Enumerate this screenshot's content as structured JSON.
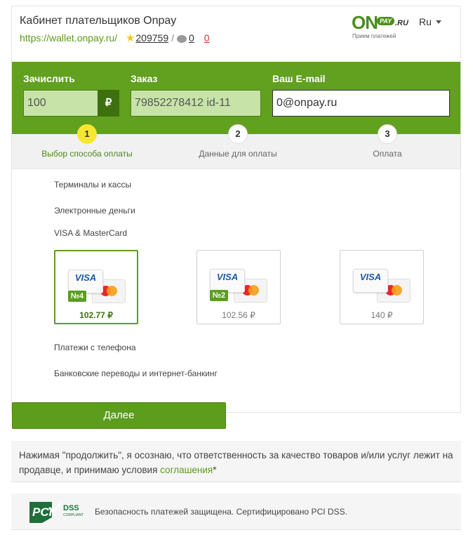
{
  "header": {
    "title": "Кабинет плательщиков Onpay",
    "url": "https://wallet.onpay.ru/",
    "rating": "209759",
    "comments": "0",
    "negative": "0",
    "logo": {
      "on": "ON",
      "pay": "PAY",
      "ru": ".RU",
      "tagline": "Прием платежей"
    },
    "lang": "Ru"
  },
  "form": {
    "amount_label": "Зачислить",
    "amount_value": "100",
    "currency": "₽",
    "order_label": "Заказ",
    "order_value": "79852278412 id-11",
    "email_label": "Ваш E-mail",
    "email_value": "0@onpay.ru"
  },
  "steps": [
    {
      "num": "1",
      "label": "Выбор способа оплаты"
    },
    {
      "num": "2",
      "label": "Данные для оплаты"
    },
    {
      "num": "3",
      "label": "Оплата"
    }
  ],
  "methods": {
    "terminals": "Терминалы и кассы",
    "emoney": "Электронные деньги",
    "cards": "VISA & MasterCard",
    "phone": "Платежи с телефона",
    "bank": "Банковские переводы и интернет-банкинг"
  },
  "card_options": [
    {
      "brand": "VISA",
      "badge": "№4",
      "price": "102.77 ₽"
    },
    {
      "brand": "VISA",
      "badge": "№2",
      "price": "102.56 ₽"
    },
    {
      "brand": "VISA",
      "badge": "",
      "price": "140 ₽"
    }
  ],
  "next_button": "Далее",
  "notice": {
    "text": "Нажимая \"продолжить\", я осознаю, что ответственность за качество товаров и/или услуг лежит на продавце, и принимаю условия ",
    "link": "соглашения",
    "suffix": "*"
  },
  "pci": {
    "logo_main": "PCI",
    "logo_dss": "DSS",
    "logo_sub": "COMPLIANT",
    "text": "Безопасность платежей защищена. Сертифицировано PCI DSS."
  },
  "colors": {
    "brand_green": "#62a020",
    "step_active": "#f7e632",
    "negative_red": "#e03030"
  }
}
